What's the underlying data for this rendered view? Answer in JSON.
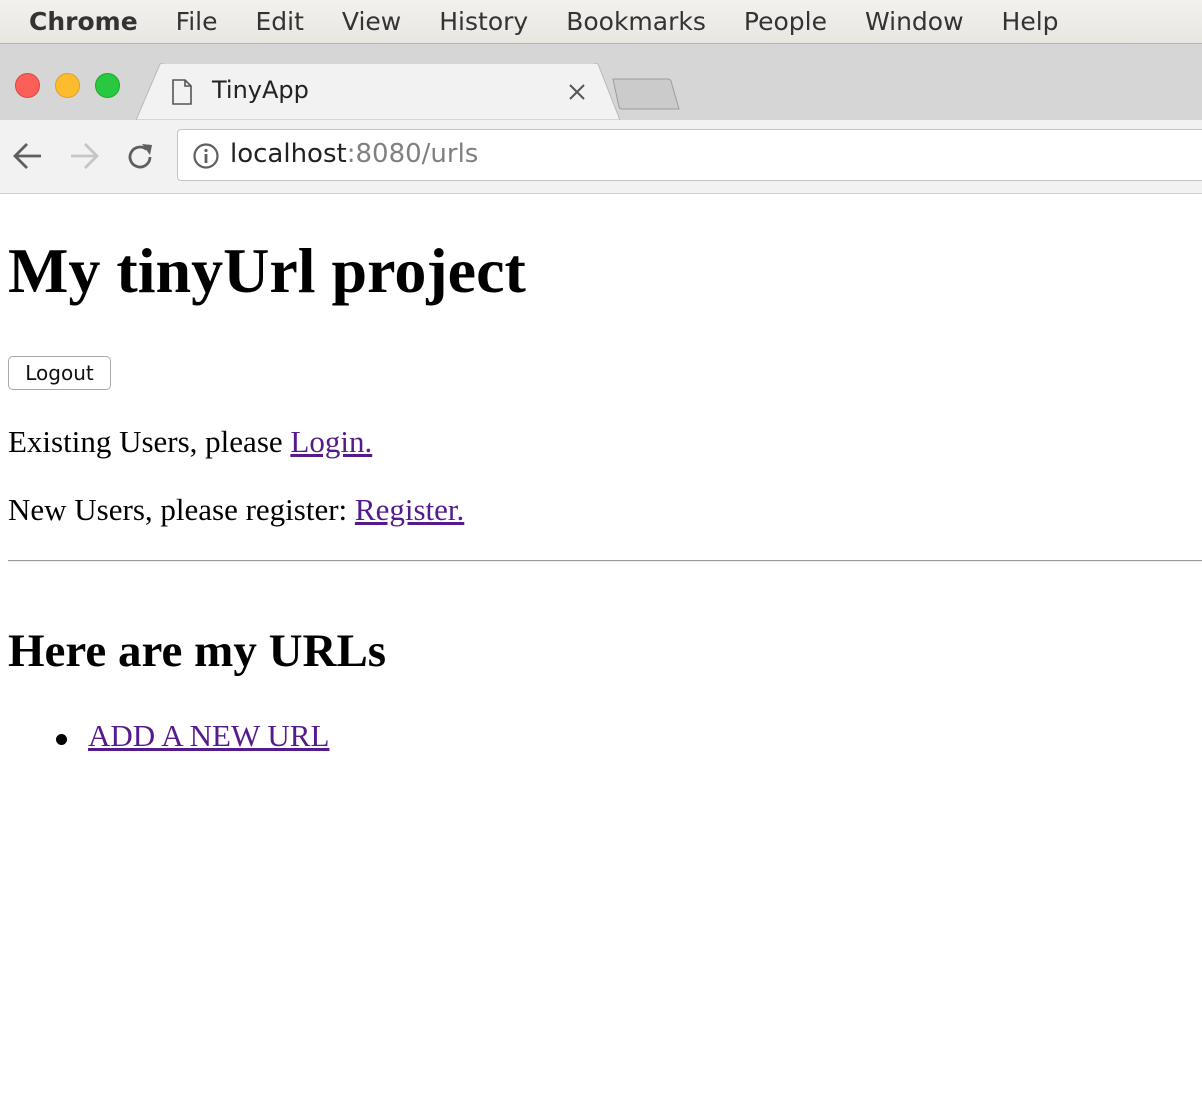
{
  "menubar": {
    "app": "Chrome",
    "items": [
      "File",
      "Edit",
      "View",
      "History",
      "Bookmarks",
      "People",
      "Window",
      "Help"
    ]
  },
  "browser": {
    "tab_title": "TinyApp",
    "url_host": "localhost",
    "url_rest": ":8080/urls"
  },
  "page": {
    "title": "My tinyUrl project",
    "logout_label": "Logout",
    "existing_text": "Existing Users, please ",
    "login_link": "Login.",
    "new_text": "New Users, please register: ",
    "register_link": "Register.",
    "urls_heading": "Here are my URLs",
    "add_url_link": "ADD A NEW URL"
  },
  "colors": {
    "link_visited": "#551a8b",
    "close": "#fc5f57",
    "minimize": "#fdbc2e",
    "zoom": "#28c840"
  }
}
